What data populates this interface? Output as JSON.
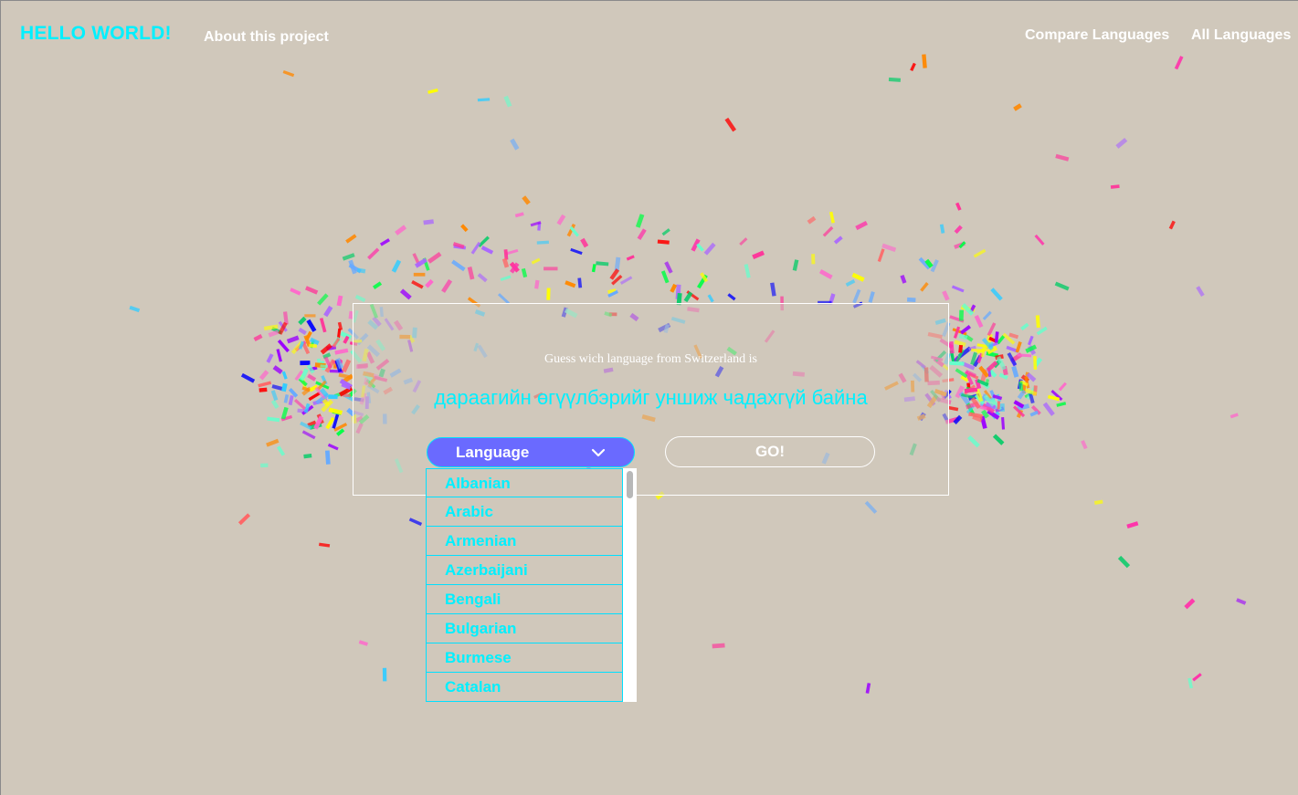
{
  "nav": {
    "brand": "HELLO WORLD!",
    "about": "About this project",
    "compare": "Compare Languages",
    "all": "All Languages"
  },
  "quiz": {
    "prompt": "Guess wich language from Switzerland is",
    "phrase": "дараагийн өгүүлбэрийг уншиж чадахгүй байна",
    "select_label": "Language",
    "go_label": "GO!"
  },
  "dropdown": {
    "options": [
      "Albanian",
      "Arabic",
      "Armenian",
      "Azerbaijani",
      "Bengali",
      "Bulgarian",
      "Burmese",
      "Catalan"
    ]
  },
  "colors": {
    "accent": "#00f0ff",
    "select_bg": "#6a6aff",
    "background": "#d0c8bb",
    "confetti": [
      "#ff0000",
      "#0000ff",
      "#9b00ff",
      "#ffff00",
      "#00ff44",
      "#ff66cc",
      "#ff8800",
      "#66ffcc",
      "#ff33aa",
      "#33ccff",
      "#aa66ff",
      "#00cc66",
      "#ff6666",
      "#66aaff",
      "#ff3399"
    ]
  }
}
